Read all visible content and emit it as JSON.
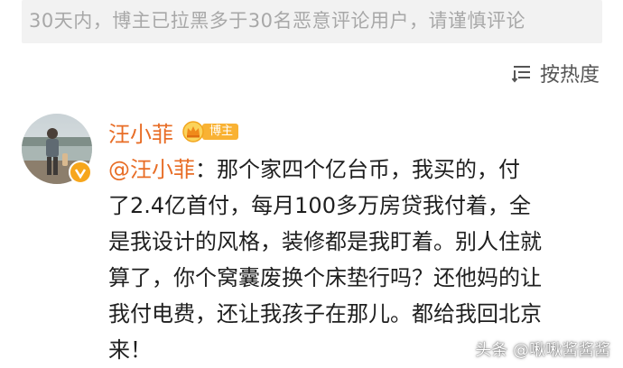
{
  "notice": {
    "text": "30天内，博主已拉黑多于30名恶意评论用户，请谨慎评论"
  },
  "sort": {
    "icon": "sort-icon",
    "label": "按热度"
  },
  "comment": {
    "author": "汪小菲",
    "badge_label": "博主",
    "badge_icon": "crown-icon",
    "mention": "@汪小菲",
    "lines": [
      "：那个家四个亿台币，我买的，付",
      "了2.4亿首付，每月100多万房贷我付着，全",
      "是我设计的风格，装修都是我盯着。别人住就",
      "算了，你个窝囊废换个床垫行吗？还他妈的让",
      "我付电费，还让我孩子在那儿。都给我回北京",
      "来！"
    ]
  },
  "watermark": {
    "text": "头条 @啾啾酱酱酱"
  },
  "colors": {
    "accent": "#e86d26",
    "badge": "#f9b233",
    "notice_bg": "#f2f2f2",
    "notice_text": "#a8a8a8",
    "body_text": "#1f1f1f"
  }
}
